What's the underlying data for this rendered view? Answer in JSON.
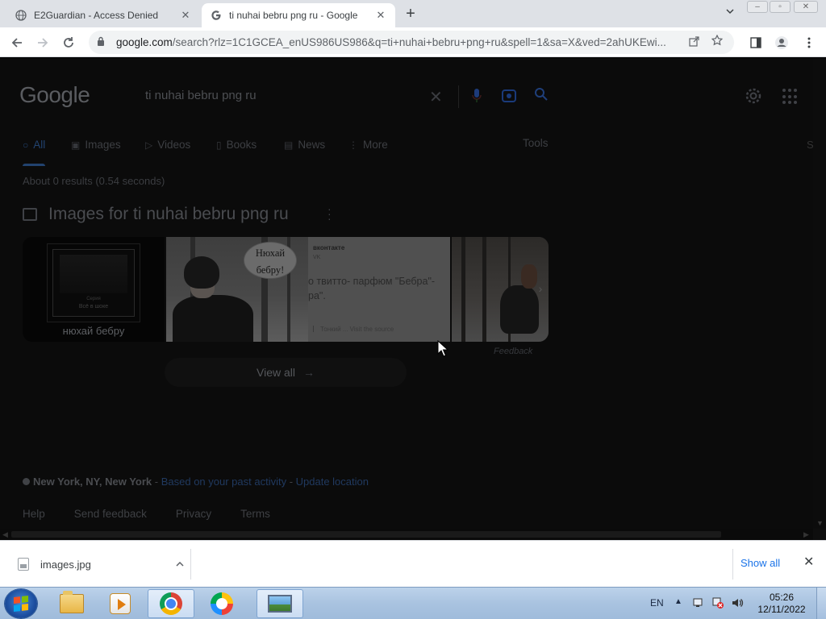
{
  "browser": {
    "tabs": [
      {
        "title": "E2Guardian - Access Denied",
        "active": false,
        "favicon": "globe-icon"
      },
      {
        "title": "ti nuhai bebru png ru - Google",
        "active": true,
        "favicon": "google-g-icon"
      }
    ],
    "new_tab_symbol": "+",
    "url_host": "google.com",
    "url_rest": "/search?rlz=1C1GCEA_enUS986US986&q=ti+nuhai+bebru+png+ru&spell=1&sa=X&ved=2ahUKEwi..."
  },
  "google": {
    "logo": "Google",
    "query": "ti nuhai bebru png ru",
    "tabs": [
      {
        "label": "All",
        "icon": "search-icon",
        "selected": true
      },
      {
        "label": "Images",
        "icon": "image-icon"
      },
      {
        "label": "Videos",
        "icon": "play-icon"
      },
      {
        "label": "Books",
        "icon": "book-icon"
      },
      {
        "label": "News",
        "icon": "news-icon"
      },
      {
        "label": "More",
        "icon": "kebab-icon"
      }
    ],
    "tools_label": "Tools",
    "edge_text": "S",
    "stats": "About 0 results (0.54 seconds)",
    "images_header": "Images for ti nuhai bebru png ru",
    "card1": {
      "poster_line1": "Серия",
      "poster_line2": "Всё в шоке",
      "caption": "нюхай бебру"
    },
    "card2": {
      "bubble_line1": "Нюхай",
      "bubble_line2": "бебру!",
      "source": "вконтакте",
      "sub": "VK",
      "body": "о твитто- парфюм \"Бебра\"-ра\".",
      "foot": "Тонкий ... Visit the source"
    },
    "feedback": "Feedback",
    "view_all": "View all",
    "location": {
      "place": "New York, NY, New York",
      "sep1": " - ",
      "based": "Based on your past activity",
      "sep2": " - ",
      "update": "Update location"
    },
    "footer": [
      "Help",
      "Send feedback",
      "Privacy",
      "Terms"
    ]
  },
  "downloads": {
    "file": "images.jpg",
    "show_all": "Show all"
  },
  "taskbar": {
    "lang": "EN",
    "time": "05:26",
    "date": "12/11/2022"
  },
  "colors": {
    "accent_link": "#1a73e8",
    "taskbar": "#a9c3e0",
    "dim_page": "#0b0b0b"
  }
}
